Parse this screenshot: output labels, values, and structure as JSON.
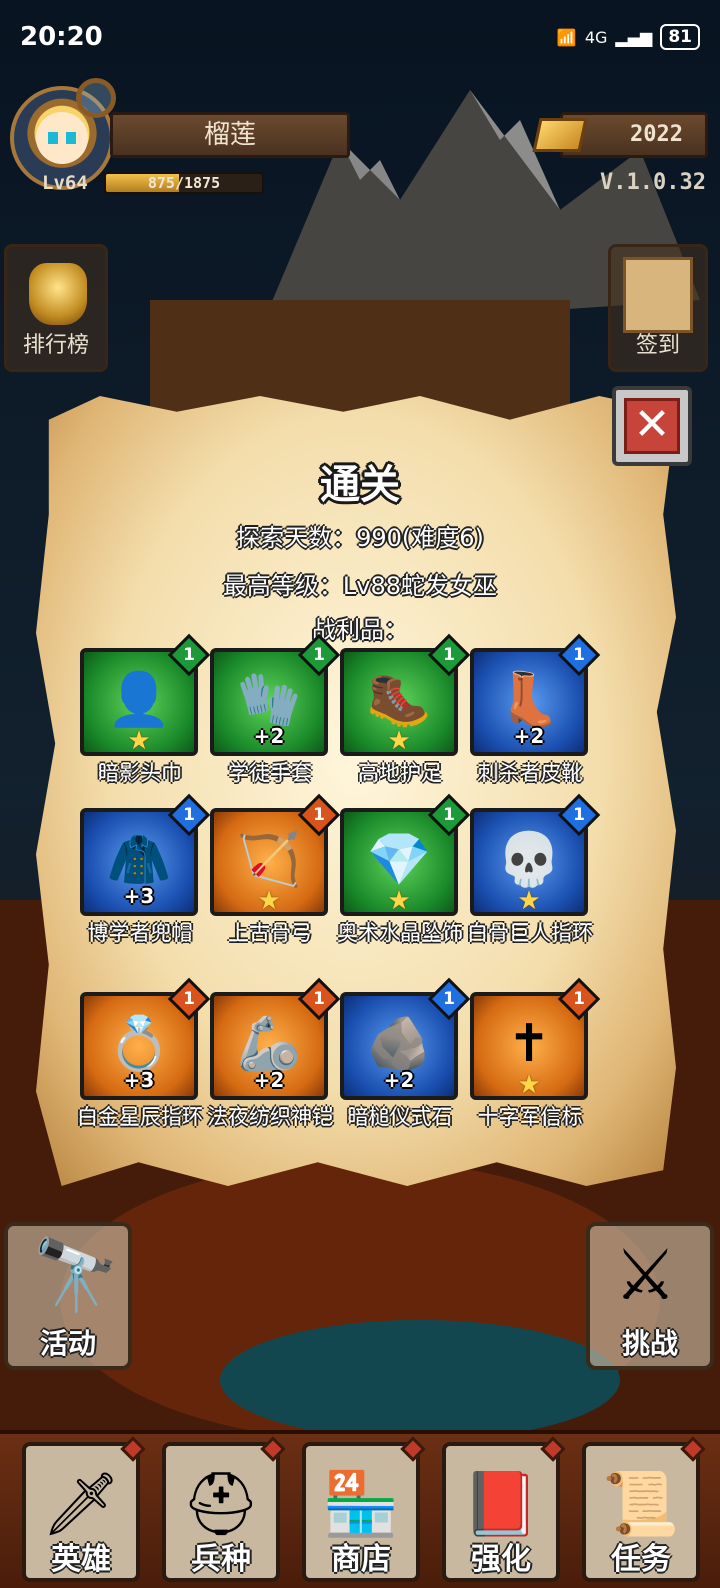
{
  "status_bar": {
    "time": "20:20",
    "network": "4G",
    "battery": "81"
  },
  "player": {
    "name": "榴莲",
    "level": "Lv64",
    "xp": "875/1875",
    "xp_fraction": 0.467,
    "gold": "2022",
    "version": "V.1.0.32"
  },
  "side_menu": {
    "ranking": "排行榜",
    "sign_in": "签到"
  },
  "dialog": {
    "title": "通关",
    "days": "探索天数：990(难度6)",
    "max_level": "最高等级：Lv88蛇发女巫",
    "loot_title": "战利品：",
    "close_icon": "close-icon",
    "items": [
      {
        "name": "暗影头巾",
        "badge": "1",
        "plus": "",
        "star": true,
        "rarity": "green",
        "icon": "👤"
      },
      {
        "name": "学徒手套",
        "badge": "1",
        "plus": "+2",
        "star": false,
        "rarity": "green",
        "icon": "🧤"
      },
      {
        "name": "高地护足",
        "badge": "1",
        "plus": "",
        "star": true,
        "rarity": "green",
        "icon": "🥾"
      },
      {
        "name": "刺杀者皮靴",
        "badge": "1",
        "plus": "+2",
        "star": false,
        "rarity": "blue",
        "icon": "👢"
      },
      {
        "name": "博学者兜帽",
        "badge": "1",
        "plus": "+3",
        "star": false,
        "rarity": "blue",
        "icon": "🧥"
      },
      {
        "name": "上古骨弓",
        "badge": "1",
        "plus": "",
        "star": true,
        "rarity": "orange",
        "icon": "🏹"
      },
      {
        "name": "奥术水晶坠饰",
        "badge": "1",
        "plus": "",
        "star": true,
        "rarity": "green",
        "icon": "💎"
      },
      {
        "name": "白骨巨人指环",
        "badge": "1",
        "plus": "",
        "star": true,
        "rarity": "blue",
        "icon": "💀"
      },
      {
        "name": "白金星辰指环",
        "badge": "1",
        "plus": "+3",
        "star": false,
        "rarity": "orange",
        "icon": "💍"
      },
      {
        "name": "法夜纺织神铠",
        "badge": "1",
        "plus": "+2",
        "star": false,
        "rarity": "orange",
        "icon": "🦾"
      },
      {
        "name": "暗槌仪式石",
        "badge": "1",
        "plus": "+2",
        "star": false,
        "rarity": "blue",
        "icon": "🪨"
      },
      {
        "name": "十字军信标",
        "badge": "1",
        "plus": "",
        "star": true,
        "rarity": "orange",
        "icon": "✝"
      }
    ]
  },
  "buttons": {
    "activity": "活动",
    "challenge": "挑战"
  },
  "nav": [
    {
      "label": "英雄",
      "icon": "🗡"
    },
    {
      "label": "兵种",
      "icon": "⛑"
    },
    {
      "label": "商店",
      "icon": "🏪"
    },
    {
      "label": "强化",
      "icon": "📕"
    },
    {
      "label": "任务",
      "icon": "📜"
    }
  ],
  "colors": {
    "green": "#1fa53a",
    "blue": "#1f5fd0",
    "orange": "#e07a14",
    "badge_green": "#1c9a3a",
    "badge_blue": "#1f6fe0",
    "badge_orange": "#d9541c"
  }
}
